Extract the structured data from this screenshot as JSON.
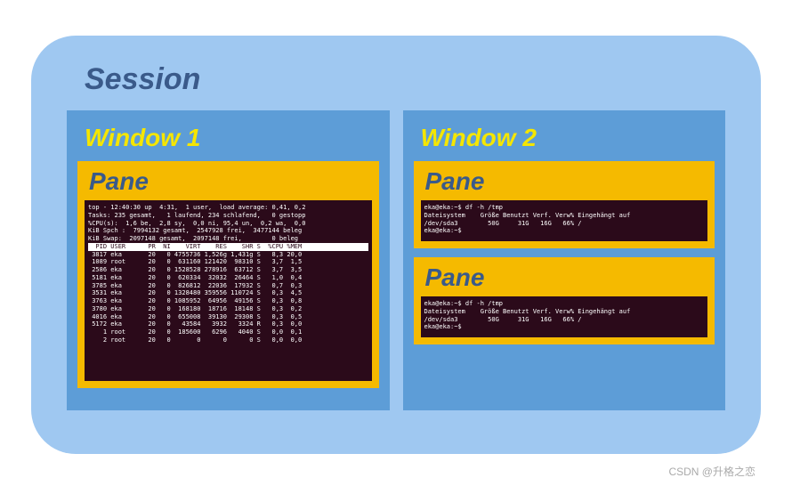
{
  "session": {
    "title": "Session"
  },
  "window1": {
    "title": "Window 1",
    "pane1": {
      "title": "Pane",
      "top_lines": "top - 12:40:30 up  4:31,  1 user,  load average: 0,41, 0,2\nTasks: 235 gesamt,   1 laufend, 234 schlafend,   0 gestopp\n%CPU(s):  1,6 be,  2,8 sy,  0,0 ni, 95,4 un,  0,2 wa,  0,0\nKiB Spch :  7994132 gesamt,  2547928 frei,  3477144 beleg\nKiB Swap:  2097148 gesamt,  2097148 frei,        0 beleg\n",
      "header": "  PID USER      PR  NI    VIRT    RES    SHR S  %CPU %MEM",
      "rows": " 3817 eka       20   0 4755736 1,526g 1,431g S   8,3 20,0\n 1089 root      20   0  631160 121420  98310 S   3,7  1,5\n 2586 eka       20   0 1528528 278916  63712 S   3,7  3,5\n 5181 eka       20   0  620334  32032  26464 S   1,0  0,4\n 3785 eka       20   0  826812  22036  17932 S   0,7  0,3\n 3531 eka       20   0 1328480 359556 110724 S   0,3  4,5\n 3763 eka       20   0 1085952  64956  49156 S   0,3  0,8\n 3780 eka       20   0  168180  18716  18148 S   0,3  0,2\n 4016 eka       20   0  655008  39130  29308 S   0,3  0,5\n 5172 eka       20   0   43584   3932   3324 R   0,3  0,0\n    1 root      20   0  185600   6296   4040 S   0,0  0,1\n    2 root      20   0       0      0      0 S   0,0  0,0"
    }
  },
  "window2": {
    "title": "Window 2",
    "pane1": {
      "title": "Pane",
      "content": "eka@eka:~$ df -h /tmp\nDateisystem    Größe Benutzt Verf. Verw% Eingehängt auf\n/dev/sda3        50G     31G   16G   66% /\neka@eka:~$ "
    },
    "pane2": {
      "title": "Pane",
      "content": "eka@eka:~$ df -h /tmp\nDateisystem    Größe Benutzt Verf. Verw% Eingehängt auf\n/dev/sda3        50G     31G   16G   66% /\neka@eka:~$ "
    }
  },
  "footer": "CSDN @升格之恋"
}
